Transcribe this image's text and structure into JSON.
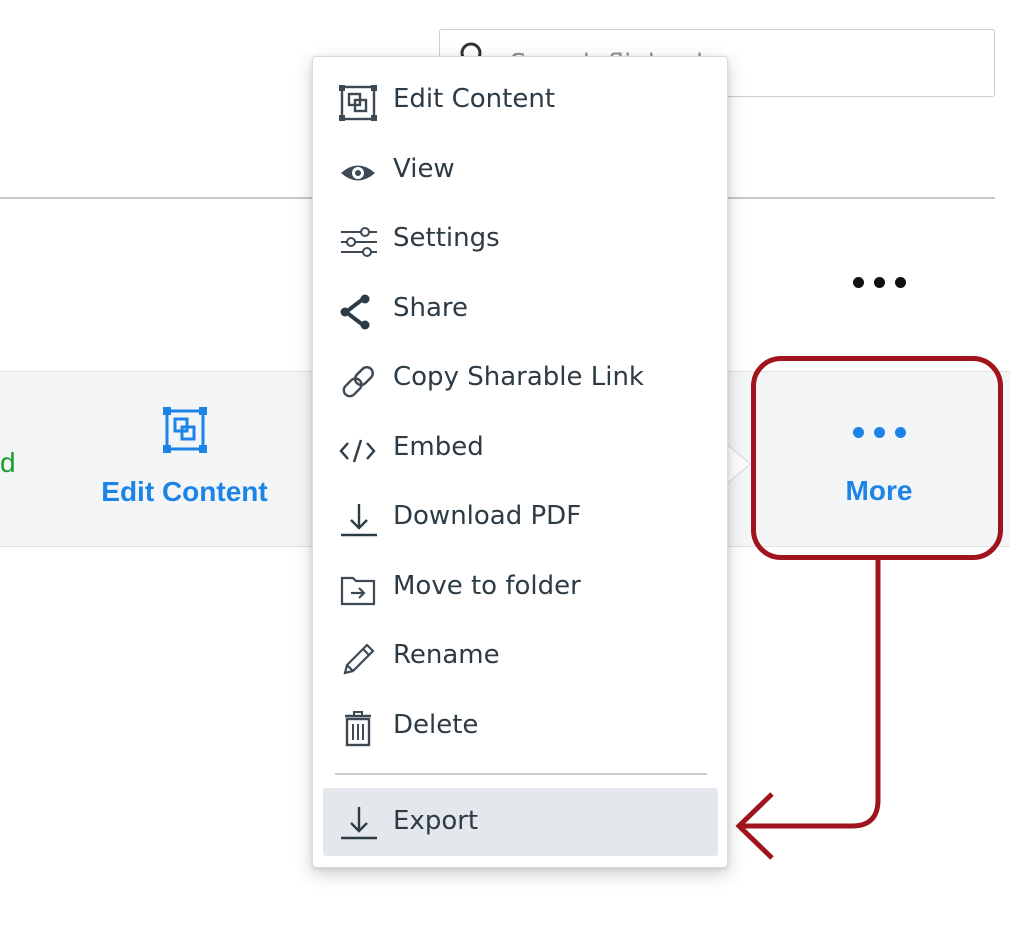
{
  "search": {
    "placeholder": "Search flipbooks"
  },
  "toolbar": {
    "partial_label": "d",
    "edit_content_label": "Edit Content",
    "more_label": "More"
  },
  "menu": {
    "items": [
      {
        "label": "Edit Content",
        "icon": "edit-content-icon"
      },
      {
        "label": "View",
        "icon": "eye-icon"
      },
      {
        "label": "Settings",
        "icon": "sliders-icon"
      },
      {
        "label": "Share",
        "icon": "share-icon"
      },
      {
        "label": "Copy Sharable Link",
        "icon": "link-icon"
      },
      {
        "label": "Embed",
        "icon": "code-icon"
      },
      {
        "label": "Download PDF",
        "icon": "download-icon"
      },
      {
        "label": "Move to folder",
        "icon": "move-folder-icon"
      },
      {
        "label": "Rename",
        "icon": "pencil-icon"
      },
      {
        "label": "Delete",
        "icon": "trash-icon"
      }
    ],
    "export_label": "Export",
    "export_icon": "download-icon"
  },
  "colors": {
    "accent_blue": "#1c84e6",
    "partial_green": "#1b9c2a",
    "annotation_red": "#a0141d",
    "menu_text": "#2d3b45",
    "active_item_bg": "#e4e8ec"
  }
}
